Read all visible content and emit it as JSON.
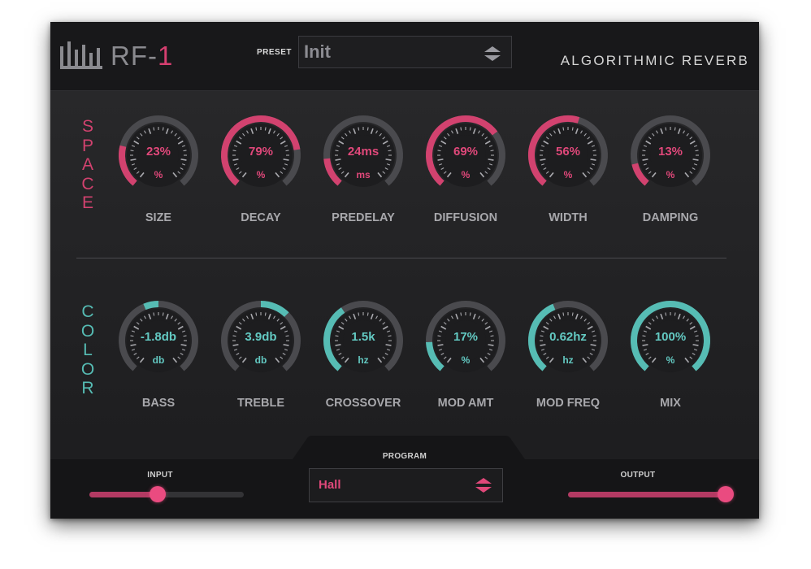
{
  "header": {
    "logo_name": "RF-",
    "logo_accent": "1",
    "preset_label": "PRESET",
    "preset_value": "Init",
    "subtitle": "ALGORITHMIC REVERB"
  },
  "sections": {
    "space": {
      "title": "SPACE",
      "color": "#d2426f"
    },
    "color": {
      "title": "COLOR",
      "color": "#56bcb4"
    }
  },
  "knobs": {
    "space": [
      {
        "label": "SIZE",
        "value": "23%",
        "unit": "%",
        "level": 0.23
      },
      {
        "label": "DECAY",
        "value": "79%",
        "unit": "%",
        "level": 0.79
      },
      {
        "label": "PREDELAY",
        "value": "24ms",
        "unit": "ms",
        "level": 0.16
      },
      {
        "label": "DIFFUSION",
        "value": "69%",
        "unit": "%",
        "level": 0.69
      },
      {
        "label": "WIDTH",
        "value": "56%",
        "unit": "%",
        "level": 0.56
      },
      {
        "label": "DAMPING",
        "value": "13%",
        "unit": "%",
        "level": 0.13
      }
    ],
    "color": [
      {
        "label": "BASS",
        "value": "-1.8db",
        "unit": "db",
        "level": 0.42,
        "bipolar": true
      },
      {
        "label": "TREBLE",
        "value": "3.9db",
        "unit": "db",
        "level": 0.66,
        "bipolar": true
      },
      {
        "label": "CROSSOVER",
        "value": "1.5k",
        "unit": "hz",
        "level": 0.38
      },
      {
        "label": "MOD AMT",
        "value": "17%",
        "unit": "%",
        "level": 0.17
      },
      {
        "label": "MOD FREQ",
        "value": "0.62hz",
        "unit": "hz",
        "level": 0.42
      },
      {
        "label": "MIX",
        "value": "100%",
        "unit": "%",
        "level": 1.0
      }
    ]
  },
  "bottom": {
    "program_label": "PROGRAM",
    "program_value": "Hall",
    "input_label": "INPUT",
    "output_label": "OUTPUT",
    "input_level": 0.44,
    "output_level": 1.0
  },
  "colors": {
    "pink": "#d2426f",
    "teal": "#56bcb4",
    "track": "#4a4a4e",
    "pink_text": "#e0487a",
    "teal_text": "#63c9c2"
  },
  "icons": {
    "logo": "bars-logo-icon",
    "preset_arrows": "up-down-arrows-icon",
    "program_arrows": "up-down-arrows-icon"
  }
}
